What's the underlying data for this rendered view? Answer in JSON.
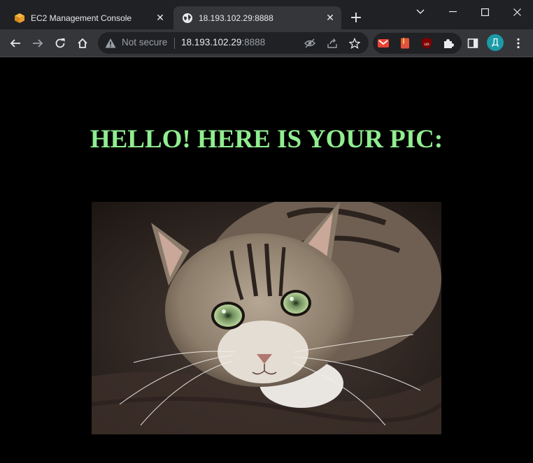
{
  "browser": {
    "tabs": [
      {
        "title": "EC2 Management Console",
        "active": false,
        "favicon": "aws-cube-icon"
      },
      {
        "title": "18.193.102.29:8888",
        "active": true,
        "favicon": "globe-icon"
      }
    ],
    "new_tab_label": "+",
    "omnibox": {
      "security_label": "Not secure",
      "host": "18.193.102.29",
      "port": ":8888"
    },
    "profile_initial": "Д",
    "extensions": [
      "gmail-icon",
      "book-icon",
      "ublock-icon",
      "puzzle-icon"
    ]
  },
  "page": {
    "heading": "HELLO! HERE IS YOUR PIC:",
    "image_alt": "tabby cat looking up",
    "background": "#000000",
    "heading_color": "#90ee90"
  }
}
